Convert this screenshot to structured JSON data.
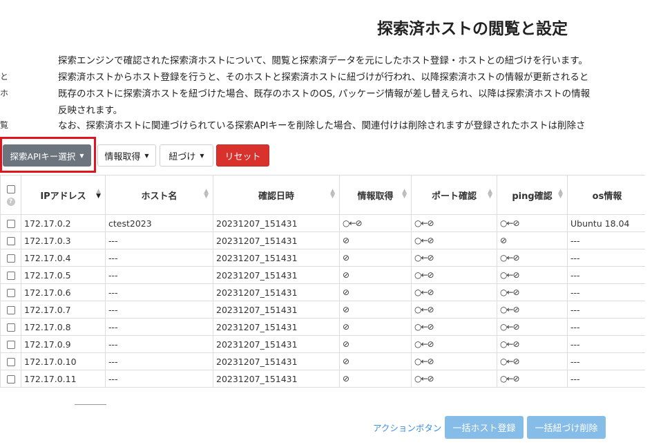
{
  "page": {
    "title": "探索済ホストの閲覧と設定"
  },
  "description": {
    "lines": [
      "探索エンジンで確認された探索済ホストについて、閲覧と探索済データを元にしたホスト登録・ホストとの紐づけを行います。",
      "探索済ホストからホスト登録を行うと、そのホストと探索済ホストに紐づけが行われ、以降探索済ホストの情報が更新されると",
      "既存のホストに探索済ホストを紐づけた場合、既存のホストのOS, パッケージ情報が差し替えられ、以降は探索済ホストの情報",
      "反映されます。",
      "なお、探索済ホストに関連づけられている探索APIキーを削除した場合、関連付けは削除されますが登録されたホストは削除さ"
    ],
    "left_fragments": [
      "と",
      "ホ",
      "",
      "",
      "覧"
    ]
  },
  "toolbar": {
    "api_key_select": "探索APIキー選択",
    "info_get": "情報取得",
    "link": "紐づけ",
    "reset": "リセット"
  },
  "table": {
    "columns": [
      "IPアドレス",
      "ホスト名",
      "確認日時",
      "情報取得",
      "ポート確認",
      "ping確認",
      "os情報"
    ],
    "rows": [
      [
        "172.17.0.2",
        "ctest2023",
        "20231207_151431",
        "○←⊘",
        "○←⊘",
        "○←⊘",
        "Ubuntu 18.04"
      ],
      [
        "172.17.0.3",
        "---",
        "20231207_151431",
        "⊘",
        "○←⊘",
        "⊘",
        "---"
      ],
      [
        "172.17.0.4",
        "---",
        "20231207_151431",
        "⊘",
        "○←⊘",
        "○←⊘",
        "---"
      ],
      [
        "172.17.0.5",
        "---",
        "20231207_151431",
        "⊘",
        "○←⊘",
        "○←⊘",
        "---"
      ],
      [
        "172.17.0.6",
        "---",
        "20231207_151431",
        "⊘",
        "○←⊘",
        "○←⊘",
        "---"
      ],
      [
        "172.17.0.7",
        "---",
        "20231207_151431",
        "⊘",
        "○←⊘",
        "○←⊘",
        "---"
      ],
      [
        "172.17.0.8",
        "---",
        "20231207_151431",
        "⊘",
        "○←⊘",
        "○←⊘",
        "---"
      ],
      [
        "172.17.0.9",
        "---",
        "20231207_151431",
        "⊘",
        "○←⊘",
        "○←⊘",
        "---"
      ],
      [
        "172.17.0.10",
        "---",
        "20231207_151431",
        "⊘",
        "○←⊘",
        "○←⊘",
        "---"
      ],
      [
        "172.17.0.11",
        "---",
        "20231207_151431",
        "⊘",
        "○←⊘",
        "○←⊘",
        "---"
      ]
    ]
  },
  "actions": {
    "label": "アクションボタン",
    "bulk_register": "一括ホスト登録",
    "bulk_unlink": "一括紐づけ削除"
  },
  "colors": {
    "highlight": "#e0141e",
    "reset_button": "#d9312c",
    "primary_disabled": "#86bde8",
    "link": "#3a8ee6",
    "api_button": "#6c757d"
  }
}
